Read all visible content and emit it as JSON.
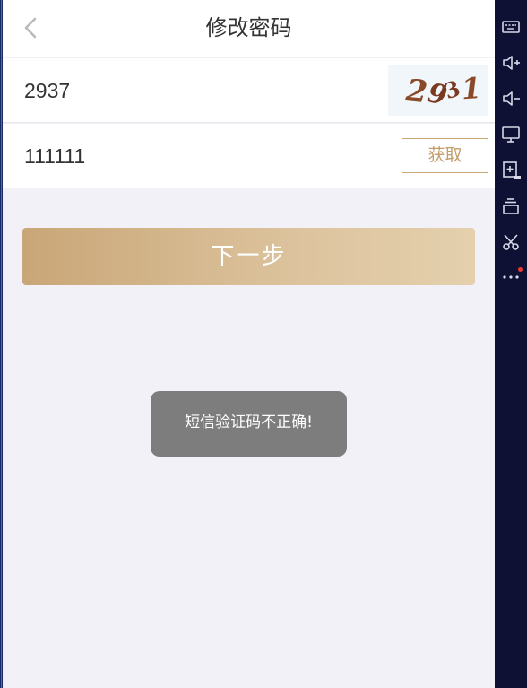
{
  "header": {
    "title": "修改密码",
    "back_icon": "chevron-left-icon"
  },
  "form": {
    "captcha_input": {
      "value": "2937"
    },
    "captcha_image": {
      "text": "2931"
    },
    "sms_code_input": {
      "value": "111111"
    },
    "get_code_label": "获取"
  },
  "next_button_label": "下一步",
  "toast": {
    "message": "短信验证码不正确!"
  },
  "toolbar": {
    "items": [
      "keyboard-icon",
      "volume-up-icon",
      "volume-down-icon",
      "screen-icon",
      "apk-install-icon",
      "layers-icon",
      "scissors-icon",
      "more-icon"
    ],
    "notification_dot_color": "#e53935"
  },
  "colors": {
    "accent": "#c9a677",
    "background": "#f2f1f7",
    "toolbar": "#0e1133"
  }
}
